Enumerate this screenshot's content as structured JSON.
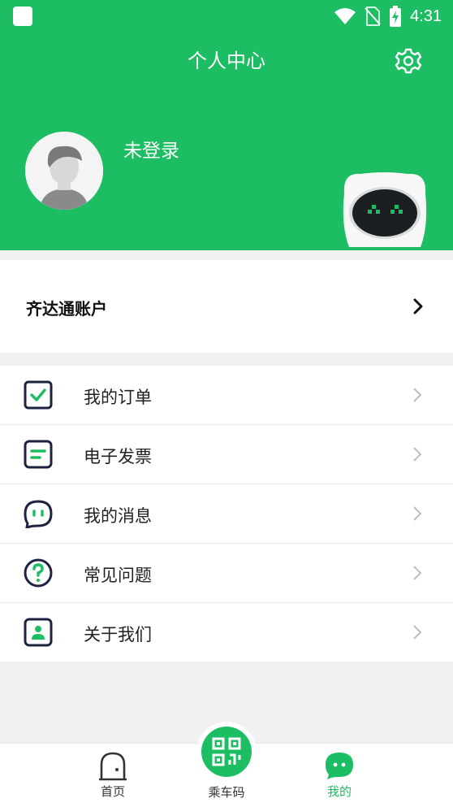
{
  "status_bar": {
    "time": "4:31",
    "icons": [
      "app-square-icon",
      "wifi-icon",
      "no-sim-icon",
      "battery-charging-icon"
    ]
  },
  "header": {
    "title": "个人中心",
    "username": "未登录",
    "settings_icon": "gear-icon",
    "background_color": "#1dbd63"
  },
  "account": {
    "label": "齐达通账户"
  },
  "menu": {
    "items": [
      {
        "label": "我的订单",
        "icon": "order-check-icon"
      },
      {
        "label": "电子发票",
        "icon": "invoice-icon"
      },
      {
        "label": "我的消息",
        "icon": "message-icon"
      },
      {
        "label": "常见问题",
        "icon": "question-icon"
      },
      {
        "label": "关于我们",
        "icon": "about-person-icon"
      }
    ]
  },
  "tabbar": {
    "home_label": "首页",
    "ride_code_label": "乘车码",
    "mine_label": "我的",
    "active_tab": "我的",
    "accent_color": "#1dbd63"
  }
}
